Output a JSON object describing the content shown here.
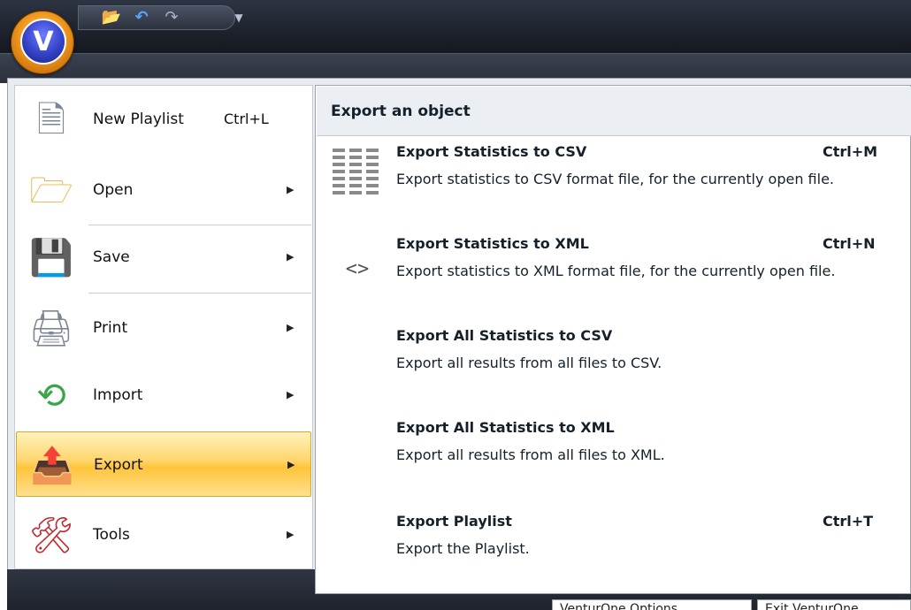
{
  "qat": {
    "app_orb_letter": "V",
    "icons": [
      "open-folder-icon",
      "undo-icon",
      "redo-icon",
      "customize-dropdown-icon"
    ]
  },
  "left_menu": {
    "items": [
      {
        "label": "New Playlist",
        "shortcut": "Ctrl+L",
        "icon": "new-playlist-icon",
        "has_submenu": false
      },
      {
        "label": "Open",
        "shortcut": "",
        "icon": "folder-icon",
        "has_submenu": true
      },
      {
        "label": "Save",
        "shortcut": "",
        "icon": "save-disk-icon",
        "has_submenu": true
      },
      {
        "label": "Print",
        "shortcut": "",
        "icon": "printer-icon",
        "has_submenu": true
      },
      {
        "label": "Import",
        "shortcut": "",
        "icon": "import-icon",
        "has_submenu": true
      },
      {
        "label": "Export",
        "shortcut": "",
        "icon": "export-icon",
        "has_submenu": true,
        "active": true
      },
      {
        "label": "Tools",
        "shortcut": "",
        "icon": "tools-icon",
        "has_submenu": true
      }
    ]
  },
  "submenu": {
    "header": "Export an object",
    "items": [
      {
        "title": "Export Statistics to CSV",
        "shortcut": "Ctrl+M",
        "desc": "Export statistics to CSV format file, for the currently open file.",
        "icon": "csv-grid-icon"
      },
      {
        "title": "Export Statistics to XML",
        "shortcut": "Ctrl+N",
        "desc": "Export statistics to XML format file, for the currently open file.",
        "icon": "xml-brackets-icon",
        "icon_text": "<>"
      },
      {
        "title": "Export All Statistics to CSV",
        "shortcut": "",
        "desc": "Export all results from all files to CSV."
      },
      {
        "title": "Export All Statistics to XML",
        "shortcut": "",
        "desc": "Export all results from all files to XML."
      },
      {
        "title": "Export Playlist",
        "shortcut": "Ctrl+T",
        "desc": "Export the Playlist."
      }
    ]
  },
  "bottom": {
    "options_button": "VenturOne Options",
    "exit_button": "Exit VenturOne"
  },
  "colors": {
    "active_highlight": "#ffd56b",
    "orb_orange": "#f39a1f",
    "orb_blue": "#3442c8",
    "titlebar": "#1b2029"
  }
}
